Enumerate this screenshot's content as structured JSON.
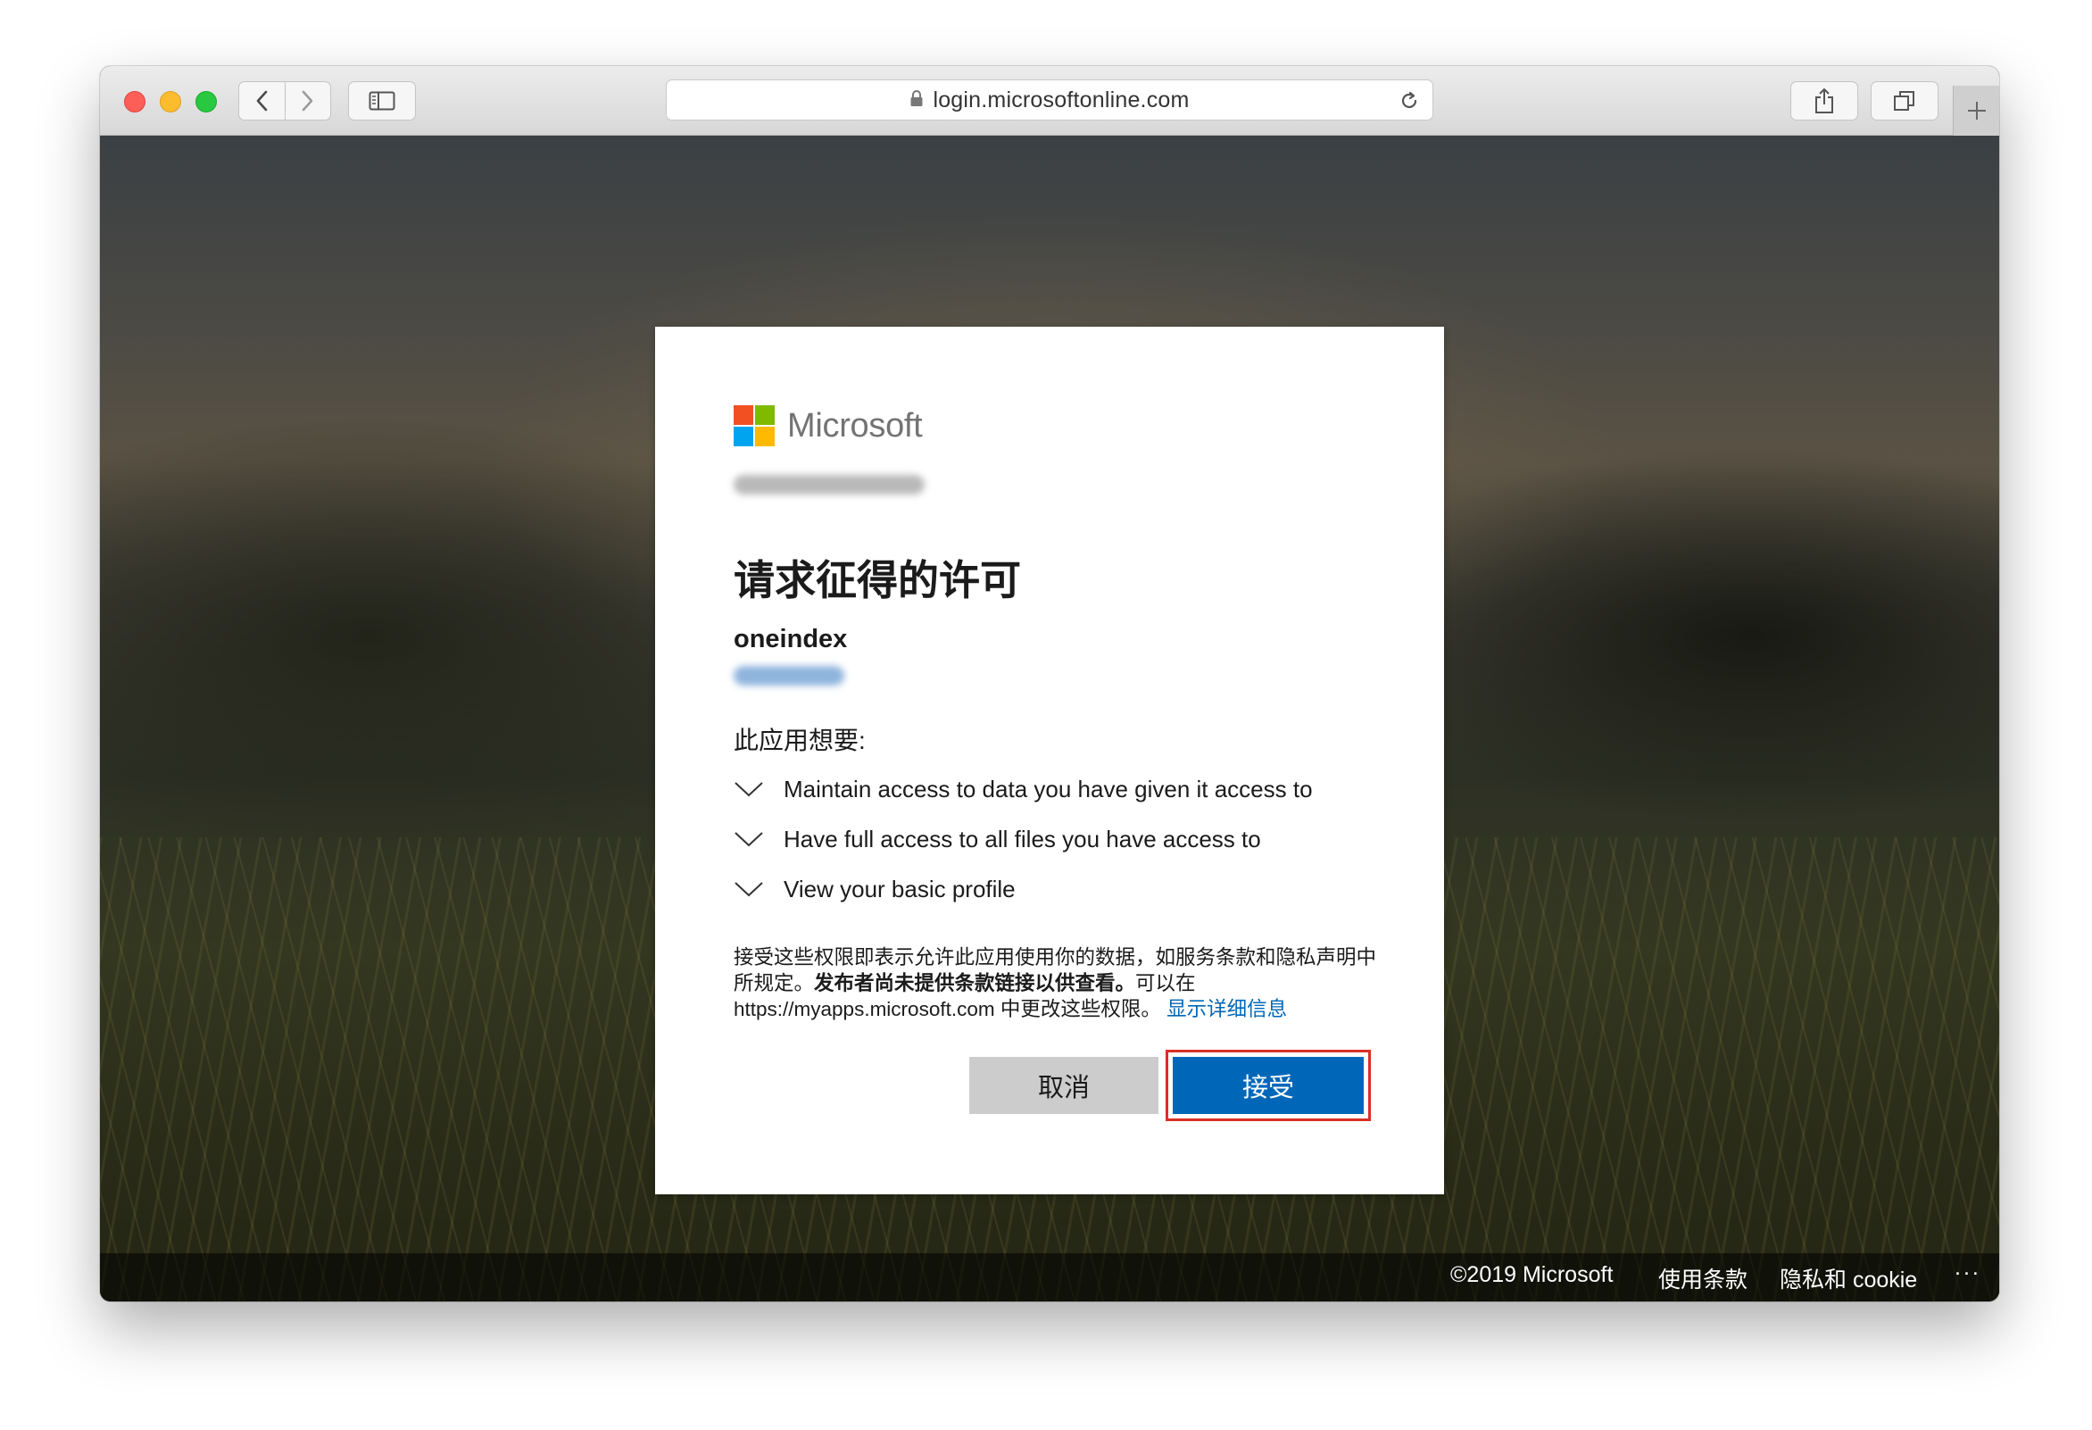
{
  "browser": {
    "url": "login.microsoftonline.com",
    "icons": {
      "back": "chevron-left-icon",
      "forward": "chevron-right-icon",
      "sidebar": "sidebar-icon",
      "lock": "lock-icon",
      "reload": "reload-icon",
      "share": "share-icon",
      "tabs": "tabs-icon",
      "new_tab": "plus-icon"
    }
  },
  "card": {
    "brand": "Microsoft",
    "title": "请求征得的许可",
    "app_name": "oneindex",
    "wants_label": "此应用想要:",
    "permissions": [
      "Maintain access to data you have given it access to",
      "Have full access to all files you have access to",
      "View your basic profile"
    ],
    "disclaimer": {
      "part1": "接受这些权限即表示允许此应用使用你的数据，如服务条款和隐私声明中所规定。",
      "bold": "发布者尚未提供条款链接以供查看。",
      "part2": "可以在 https://myapps.microsoft.com 中更改这些权限。 ",
      "link": "显示详细信息"
    },
    "cancel_label": "取消",
    "accept_label": "接受"
  },
  "footer": {
    "copyright": "©2019 Microsoft",
    "terms": "使用条款",
    "privacy": "隐私和 cookie",
    "more": "..."
  },
  "colors": {
    "accent": "#0067b8",
    "highlight": "#d93025",
    "cancel_bg": "#cccccc"
  }
}
